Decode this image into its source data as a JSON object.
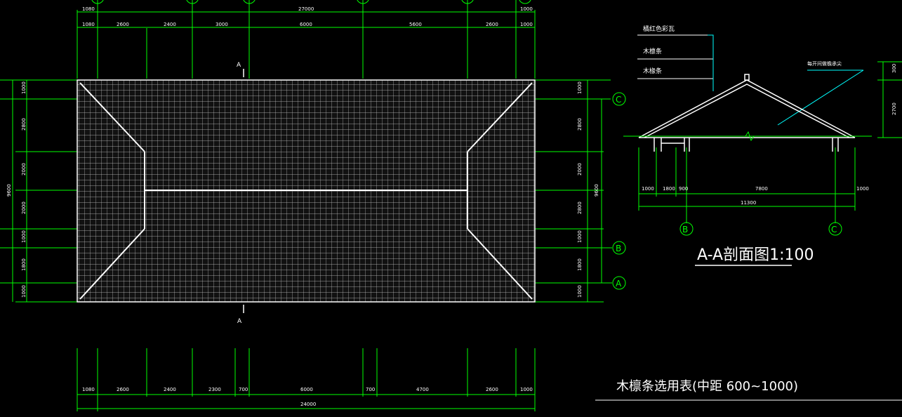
{
  "plan": {
    "top_overall": "27000",
    "top_upper": [
      "1080",
      "1000"
    ],
    "top_dims": [
      "1080",
      "2600",
      "2400",
      "3000",
      "6000",
      "5600",
      "2600",
      "1000"
    ],
    "bottom_dims": [
      "1080",
      "2600",
      "2400",
      "2300",
      "700",
      "6000",
      "700",
      "4700",
      "2600",
      "1000"
    ],
    "bottom_overall": "24000",
    "left_dims": [
      "1000",
      "2800",
      "2000",
      "2000",
      "1000",
      "1800",
      "1000"
    ],
    "left_overall": "9600",
    "right_dims": [
      "1000",
      "2800",
      "2000",
      "2800",
      "1000",
      "1800",
      "1000"
    ],
    "right_overall": "9600",
    "section_mark_top": "A",
    "section_mark_bottom": "A",
    "axes": {
      "c": "C",
      "b": "B",
      "a": "A"
    }
  },
  "section": {
    "labels": [
      "橘红色彩瓦",
      "木檩条",
      "木椽条"
    ],
    "ridge_note": "每开间做檐承尖",
    "right_dims": [
      "300",
      "2700"
    ],
    "bottom_dims": [
      "1000",
      "1800",
      "900",
      "7800",
      "1000"
    ],
    "overall": "11300",
    "axes": {
      "b": "B",
      "c": "C"
    },
    "title": "A-A剖面图1:100"
  },
  "table_title": "木檩条选用表(中距 600~1000)"
}
